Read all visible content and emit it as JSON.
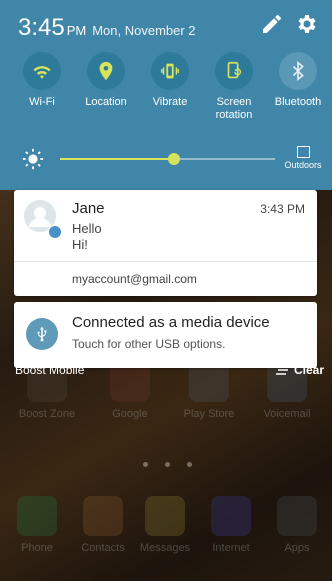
{
  "status_bar": {
    "time": "3:45",
    "ampm": "PM",
    "date": "Mon, November 2"
  },
  "quick_settings": [
    {
      "label": "Wi-Fi",
      "icon": "wifi-icon",
      "on": true
    },
    {
      "label": "Location",
      "icon": "location-icon",
      "on": true
    },
    {
      "label": "Vibrate",
      "icon": "vibrate-icon",
      "on": true
    },
    {
      "label": "Screen\nrotation",
      "icon": "screen-rotation-icon",
      "on": true
    },
    {
      "label": "Bluetooth",
      "icon": "bluetooth-icon",
      "on": false
    }
  ],
  "brightness": {
    "level": 0.53,
    "outdoors_label": "Outdoors"
  },
  "notifications": {
    "message": {
      "sender": "Jane",
      "time": "3:43 PM",
      "line1": "Hello",
      "line2": "Hi!",
      "account": "myaccount@gmail.com"
    },
    "usb": {
      "title": "Connected as a media device",
      "subtitle": "Touch for other USB options."
    }
  },
  "footer": {
    "carrier": "Boost Mobile",
    "clear_label": "Clear"
  },
  "home_apps": {
    "row1": [
      "Boost Zone",
      "Google",
      "Play Store",
      "Voicemail"
    ],
    "dock": [
      "Phone",
      "Contacts",
      "Messages",
      "Internet",
      "Apps"
    ]
  },
  "colors": {
    "shade": "#3f86a8",
    "accent": "#d7e35b"
  }
}
